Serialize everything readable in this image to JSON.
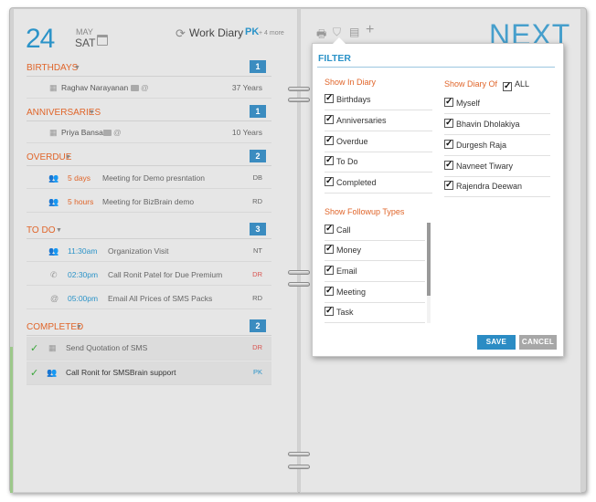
{
  "date": {
    "day": "24",
    "month": "MAY",
    "weekday": "SAT"
  },
  "header": {
    "title": "Work Diary",
    "user": "PK",
    "more": "+ 4 more"
  },
  "next_label": "NEXT",
  "sections": {
    "birthdays": {
      "title": "BIRTHDAYS",
      "count": "1",
      "rows": [
        {
          "name": "Raghav Narayanan",
          "age": "37 Years"
        }
      ]
    },
    "anniversaries": {
      "title": "ANNIVERSARIES",
      "count": "1",
      "rows": [
        {
          "name": "Priya Bansal",
          "age": "10 Years"
        }
      ]
    },
    "overdue": {
      "title": "OVERDUE",
      "count": "2",
      "rows": [
        {
          "when": "5 days",
          "text": "Meeting for Demo presntation",
          "by": "DB"
        },
        {
          "when": "5 hours",
          "text": "Meeting for BizBrain demo",
          "by": "RD"
        }
      ]
    },
    "todo": {
      "title": "TO DO",
      "count": "3",
      "rows": [
        {
          "time": "11:30am",
          "text": "Organization Visit",
          "by": "NT"
        },
        {
          "time": "02:30pm",
          "text": "Call Ronit Patel for Due Premium",
          "by": "DR"
        },
        {
          "time": "05:00pm",
          "text": "Email All Prices of SMS Packs",
          "by": "RD"
        }
      ]
    },
    "completed": {
      "title": "COMPLETED",
      "count": "2",
      "rows": [
        {
          "text": "Send Quotation of SMS",
          "by": "DR"
        },
        {
          "text": "Call Ronit for SMSBrain support",
          "by": "PK"
        }
      ]
    }
  },
  "filter": {
    "title": "FILTER",
    "show_in_diary_title": "Show In Diary",
    "show_in_diary": [
      "Birthdays",
      "Anniversaries",
      "Overdue",
      "To Do",
      "Completed"
    ],
    "followup_title": "Show Followup Types",
    "followup_types": [
      "Call",
      "Money",
      "Email",
      "Meeting",
      "Task"
    ],
    "show_diary_of_title": "Show Diary Of",
    "all_label": "ALL",
    "diary_of": [
      "Myself",
      "Bhavin Dholakiya",
      "Durgesh Raja",
      "Navneet Tiwary",
      "Rajendra Deewan"
    ],
    "save_label": "SAVE",
    "cancel_label": "CANCEL"
  },
  "colors": {
    "accent": "#2b93c8",
    "section": "#e0652a",
    "count_badge": "#3b8cc0"
  }
}
